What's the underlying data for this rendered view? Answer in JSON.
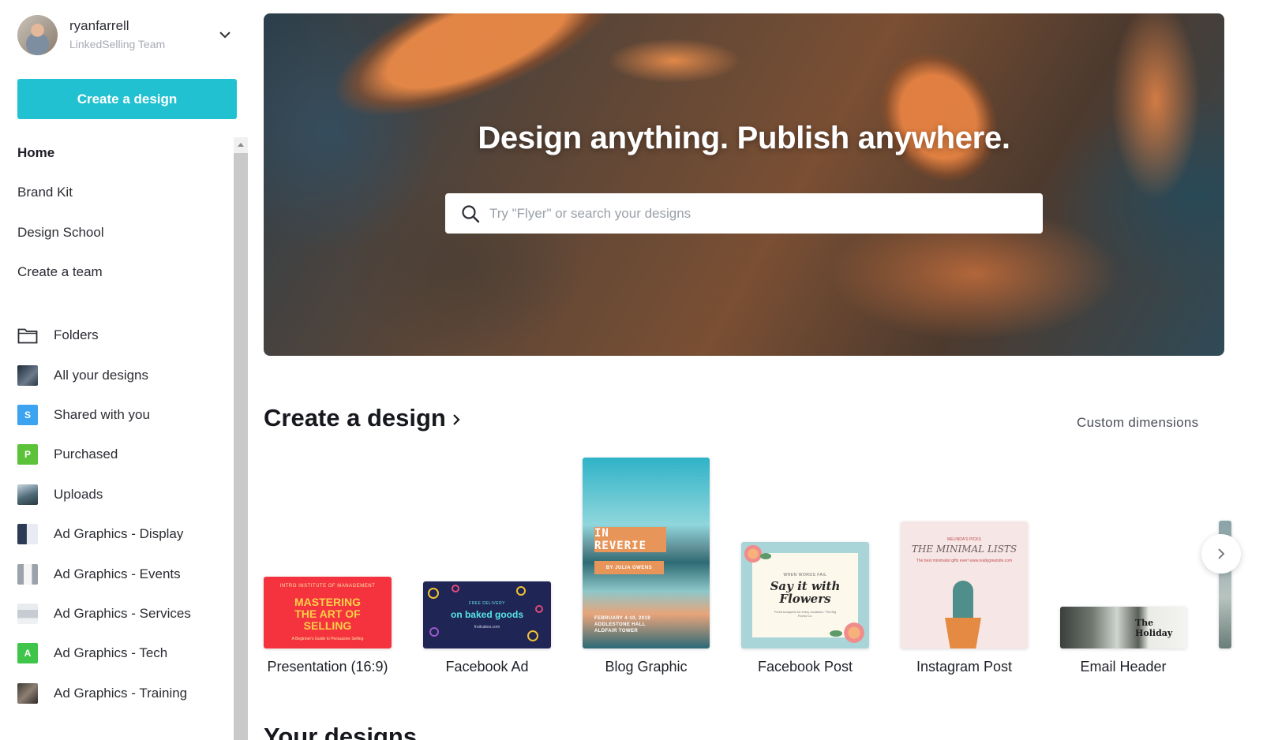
{
  "account": {
    "name": "ryanfarrell",
    "team": "LinkedSelling Team"
  },
  "sidebar": {
    "create_button": "Create a design",
    "primary_nav": [
      {
        "label": "Home",
        "active": true
      },
      {
        "label": "Brand Kit"
      },
      {
        "label": "Design School"
      },
      {
        "label": "Create a team"
      }
    ],
    "folder_nav": [
      {
        "label": "Folders",
        "icon": "folder-icon"
      },
      {
        "label": "All your designs",
        "icon": "thumbnail"
      },
      {
        "label": "Shared with you",
        "icon": "letter-badge",
        "badge": "S",
        "badge_color": "#3ba3f0"
      },
      {
        "label": "Purchased",
        "icon": "letter-badge",
        "badge": "P",
        "badge_color": "#5cc239"
      },
      {
        "label": "Uploads",
        "icon": "thumbnail"
      },
      {
        "label": "Ad Graphics - Display",
        "icon": "thumbnail"
      },
      {
        "label": "Ad Graphics - Events",
        "icon": "thumbnail"
      },
      {
        "label": "Ad Graphics - Services",
        "icon": "thumbnail"
      },
      {
        "label": "Ad Graphics - Tech",
        "icon": "letter-badge",
        "badge": "A",
        "badge_color": "#3fc54a"
      },
      {
        "label": "Ad Graphics - Training",
        "icon": "thumbnail"
      }
    ]
  },
  "hero": {
    "title": "Design anything. Publish anywhere.",
    "search_placeholder": "Try \"Flyer\" or search your designs"
  },
  "create_section": {
    "title": "Create a design",
    "custom_dimensions": "Custom dimensions",
    "cards": [
      {
        "label": "Presentation (16:9)",
        "thumb": {
          "small": "INTRO INSTITUTE OF MANAGEMENT",
          "big": "MASTERING THE ART OF SELLING",
          "tiny": "A Beginner's Guide to Persuasive Selling"
        }
      },
      {
        "label": "Facebook Ad",
        "thumb": {
          "small": "FREE DELIVERY",
          "big": "on baked goods",
          "tiny": "fruitcakes.com"
        }
      },
      {
        "label": "Blog Graphic",
        "thumb": {
          "big": "IN REVERIE",
          "by": "BY JULIA OWENS",
          "date": "FEBRUARY 4-10, 2019",
          "venue": "ADDLESTONE HALL",
          "venue2": "ALDFAIR TOWER"
        }
      },
      {
        "label": "Facebook Post",
        "thumb": {
          "small": "WHEN WORDS FAIL",
          "big": "Say it with Flowers",
          "tiny": "Fresh bouquets for every occasion / The Big Florist Co."
        }
      },
      {
        "label": "Instagram Post",
        "thumb": {
          "small": "MELINDA'S PICKS",
          "big": "THE MINIMAL LISTS",
          "tiny": "The best minimalist gifts ever! www.reallygreatsite.com"
        }
      },
      {
        "label": "Email Header",
        "thumb": {
          "big": "The Holiday"
        }
      }
    ]
  },
  "your_designs": {
    "title": "Your designs"
  },
  "colors": {
    "accent": "#21c1d1",
    "text_dark": "#1f2129",
    "text_muted": "#a7abb3"
  }
}
